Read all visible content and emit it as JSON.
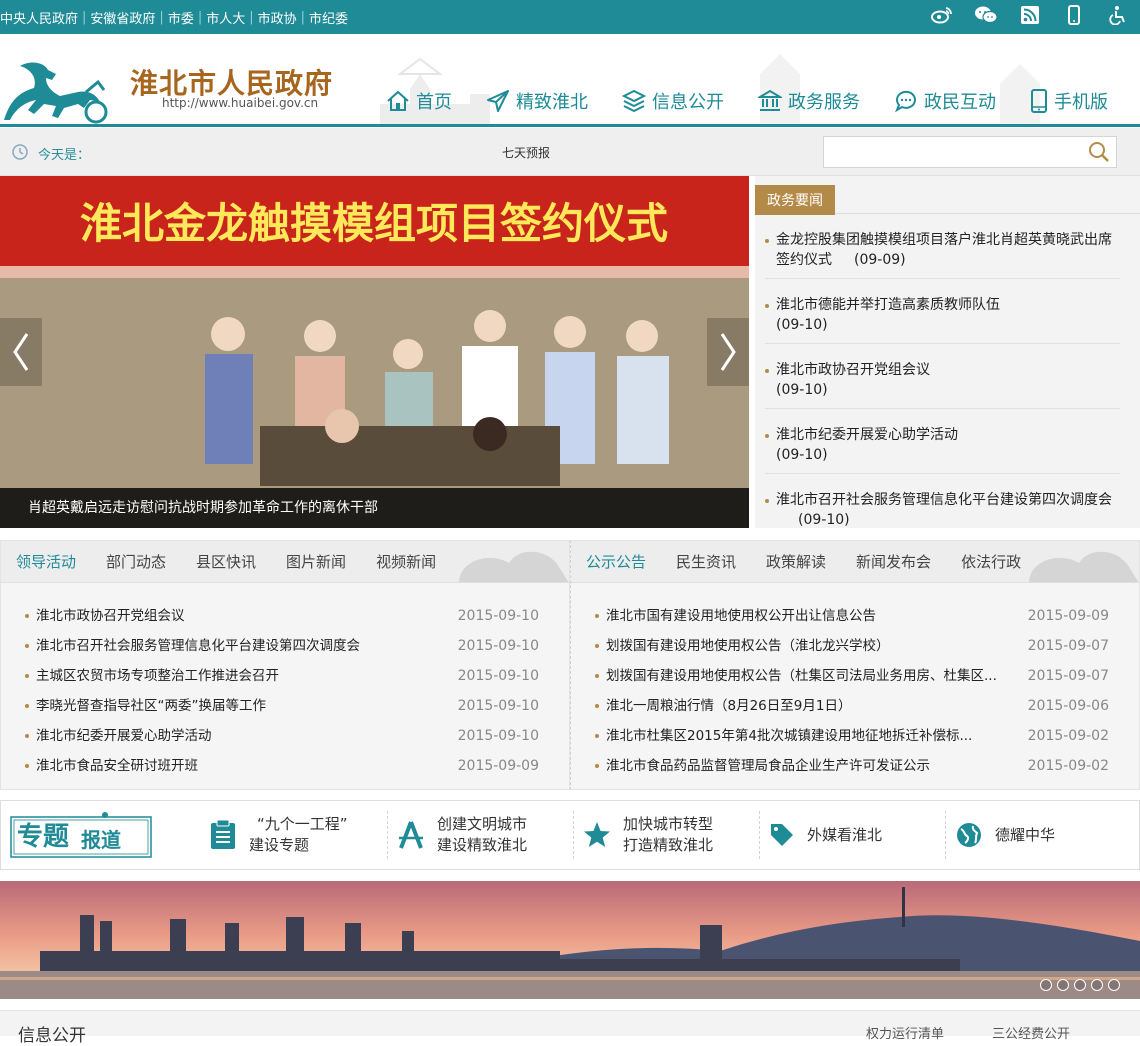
{
  "topbar": {
    "links": [
      "中央人民政府",
      "安徽省政府",
      "市委",
      "市人大",
      "市政协",
      "市纪委"
    ],
    "separator": "|",
    "icons": [
      "weibo-icon",
      "wechat-icon",
      "rss-icon",
      "mobile-icon",
      "accessibility-icon"
    ]
  },
  "header": {
    "title": "淮北市人民政府",
    "url": "http://www.huaibei.gov.cn"
  },
  "nav": [
    {
      "label": "首页",
      "icon": "home-icon"
    },
    {
      "label": "精致淮北",
      "icon": "paper-plane-icon"
    },
    {
      "label": "信息公开",
      "icon": "layers-icon"
    },
    {
      "label": "政务服务",
      "icon": "government-building-icon"
    },
    {
      "label": "政民互动",
      "icon": "chat-bubble-icon"
    },
    {
      "label": "手机版",
      "icon": "phone-icon"
    }
  ],
  "datebar": {
    "today_label": "今天是：",
    "forecast_label": "七天预报",
    "search_placeholder": ""
  },
  "slider": {
    "banner_text": "淮北金龙触摸模组项目签约仪式",
    "caption": "肖超英戴启远走访慰问抗战时期参加革命工作的离休干部"
  },
  "gov_news": {
    "tag": "政务要闻",
    "items": [
      {
        "title": "金龙控股集团触摸模组项目落户淮北肖超英黄晓武出席签约仪式",
        "date": "(09-09)"
      },
      {
        "title": "淮北市德能并举打造高素质教师队伍",
        "date": "(09-10)"
      },
      {
        "title": "淮北市政协召开党组会议",
        "date": "(09-10)"
      },
      {
        "title": "淮北市纪委开展爱心助学活动",
        "date": "(09-10)"
      },
      {
        "title": "淮北市召开社会服务管理信息化平台建设第四次调度会",
        "date": "(09-10)"
      }
    ]
  },
  "left_tabs": {
    "tabs": [
      "领导活动",
      "部门动态",
      "县区快讯",
      "图片新闻",
      "视频新闻"
    ],
    "active": 0,
    "items": [
      {
        "title": "淮北市政协召开党组会议",
        "date": "2015-09-10"
      },
      {
        "title": "淮北市召开社会服务管理信息化平台建设第四次调度会",
        "date": "2015-09-10"
      },
      {
        "title": "主城区农贸市场专项整治工作推进会召开",
        "date": "2015-09-10"
      },
      {
        "title": "李晓光督查指导社区“两委”换届等工作",
        "date": "2015-09-10"
      },
      {
        "title": "淮北市纪委开展爱心助学活动",
        "date": "2015-09-10"
      },
      {
        "title": "淮北市食品安全研讨班开班",
        "date": "2015-09-09"
      }
    ]
  },
  "right_tabs": {
    "tabs": [
      "公示公告",
      "民生资讯",
      "政策解读",
      "新闻发布会",
      "依法行政"
    ],
    "active": 0,
    "items": [
      {
        "title": "淮北市国有建设用地使用权公开出让信息公告",
        "date": "2015-09-09"
      },
      {
        "title": "划拨国有建设用地使用权公告（淮北龙兴学校）",
        "date": "2015-09-07"
      },
      {
        "title": "划拨国有建设用地使用权公告（杜集区司法局业务用房、杜集区...",
        "date": "2015-09-07"
      },
      {
        "title": "淮北一周粮油行情（8月26日至9月1日）",
        "date": "2015-09-06"
      },
      {
        "title": "淮北市杜集区2015年第4批次城镇建设用地征地拆迁补偿标...",
        "date": "2015-09-02"
      },
      {
        "title": "淮北市食品药品监督管理局食品企业生产许可发证公示",
        "date": "2015-09-02"
      }
    ]
  },
  "special": {
    "brand_big": "专题",
    "brand_small": "报道",
    "items": [
      {
        "line1": "“九个一工程”",
        "line2": "建设专题",
        "icon": "clipboard-icon"
      },
      {
        "line1": "创建文明城市",
        "line2": "建设精致淮北",
        "icon": "compass-icon"
      },
      {
        "line1": "加快城市转型",
        "line2": "打造精致淮北",
        "icon": "star-icon"
      },
      {
        "line1": "外媒看淮北",
        "line2": "",
        "icon": "tag-icon"
      },
      {
        "line1": "德耀中华",
        "line2": "",
        "icon": "globe-icon"
      }
    ]
  },
  "banner": {
    "dot_count": 5
  },
  "infobar": {
    "title": "信息公开",
    "links": [
      "权力运行清单",
      "三公经费公开"
    ]
  },
  "colors": {
    "primary": "#1f8b96",
    "accent": "#b48a48",
    "title": "#a8651d"
  }
}
